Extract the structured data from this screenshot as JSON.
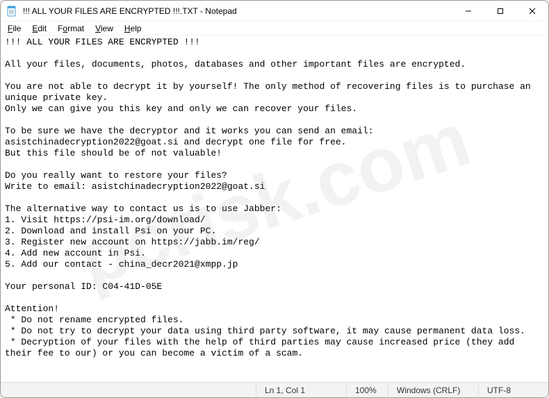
{
  "titlebar": {
    "title": "!!! ALL YOUR FILES ARE ENCRYPTED !!!.TXT - Notepad"
  },
  "window_controls": {
    "minimize": "minimize",
    "maximize": "maximize",
    "close": "close"
  },
  "menubar": {
    "file": "File",
    "edit": "Edit",
    "format": "Format",
    "view": "View",
    "help": "Help"
  },
  "body_text": "!!! ALL YOUR FILES ARE ENCRYPTED !!!\n\nAll your files, documents, photos, databases and other important files are encrypted.\n\nYou are not able to decrypt it by yourself! The only method of recovering files is to purchase an unique private key.\nOnly we can give you this key and only we can recover your files.\n\nTo be sure we have the decryptor and it works you can send an email: asistchinadecryption2022@goat.si and decrypt one file for free.\nBut this file should be of not valuable!\n\nDo you really want to restore your files?\nWrite to email: asistchinadecryption2022@goat.si\n\nThe alternative way to contact us is to use Jabber:\n1. Visit https://psi-im.org/download/\n2. Download and install Psi on your PC.\n3. Register new account on https://jabb.im/reg/\n4. Add new account in Psi.\n5. Add our contact - china_decr2021@xmpp.jp\n\nYour personal ID: C04-41D-05E\n\nAttention!\n * Do not rename encrypted files.\n * Do not try to decrypt your data using third party software, it may cause permanent data loss.\n * Decryption of your files with the help of third parties may cause increased price (they add their fee to our) or you can become a victim of a scam.",
  "statusbar": {
    "caret": "Ln 1, Col 1",
    "zoom": "100%",
    "line_ending": "Windows (CRLF)",
    "encoding": "UTF-8"
  },
  "watermark": "pcrisk.com"
}
